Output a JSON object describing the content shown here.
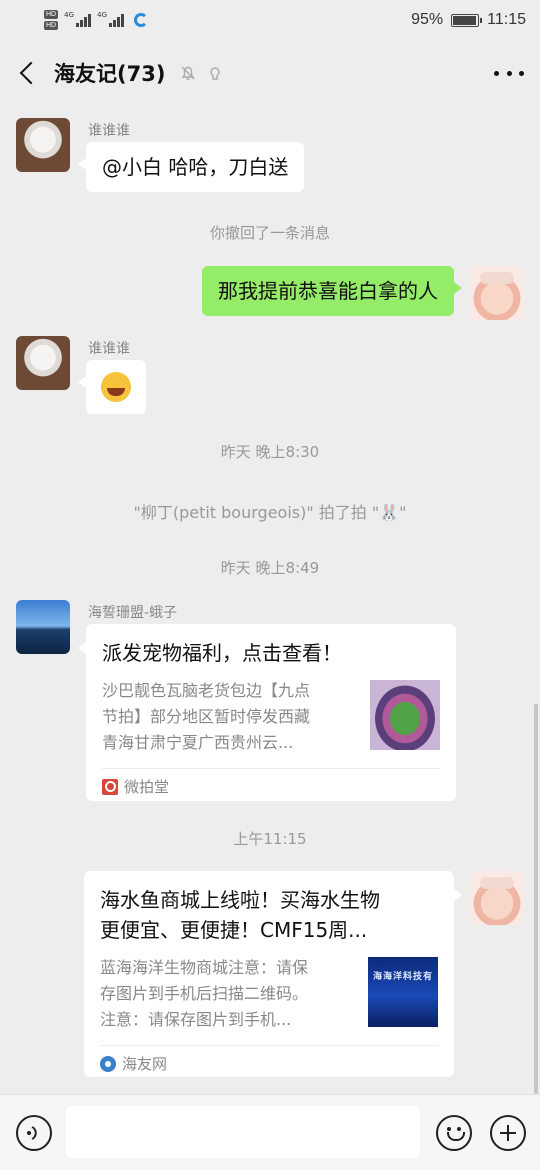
{
  "status_bar": {
    "hd_1": "HD",
    "hd_2": "HD",
    "net_1": "4G",
    "net_2": "4G",
    "battery_percent": "95%",
    "battery_level": 0.95,
    "time": "11:15"
  },
  "header": {
    "title": "海友记(73)",
    "back_icon": "chevron-left-icon",
    "mute_icon": "bell-off-icon",
    "extra_icon": "earmark-icon",
    "more_icon": "more-dots-icon"
  },
  "messages": {
    "m1": {
      "sender": "谁谁谁",
      "text": "@小白  哈哈，刀白送"
    },
    "recall": "你撤回了一条消息",
    "m2": {
      "text": "那我提前恭喜能白拿的人"
    },
    "m3": {
      "sender": "谁谁谁",
      "emoji": "laughing-crying-emoji"
    },
    "time_1": "昨天 晚上8:30",
    "pat": "\"柳丁(petit bourgeois)\" 拍了拍 \"🐰\"",
    "time_2": "昨天 晚上8:49",
    "m4": {
      "sender": "海誓珊盟-蛾子",
      "title": "派发宠物福利，点击查看！",
      "desc_1": "沙巴靓色瓦脑老货包边【九点",
      "desc_2": "节拍】部分地区暂时停发西藏",
      "desc_3": "青海甘肃宁夏广西贵州云...",
      "source": "微拍堂"
    },
    "time_3": "上午11:15",
    "m5": {
      "title_1": "海水鱼商城上线啦！买海水生物",
      "title_2": "更便宜、更便捷！CMF15周...",
      "desc_1": "蓝海海洋生物商城注意：请保",
      "desc_2": "存图片到手机后扫描二维码。",
      "desc_3": "注意：请保存图片到手机...",
      "thumb_text": "海海洋科技有",
      "source": "海友网"
    }
  },
  "input_bar": {
    "voice_icon": "voice-icon",
    "text_value": "",
    "emoji_icon": "smile-icon",
    "plus_icon": "plus-icon"
  }
}
